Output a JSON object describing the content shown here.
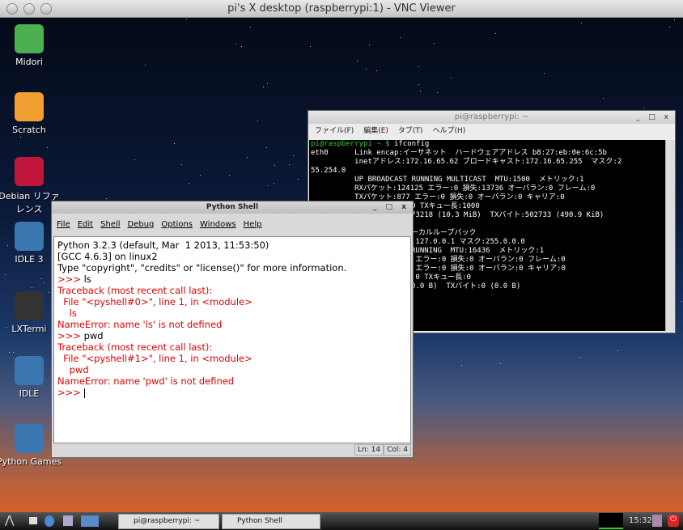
{
  "window": {
    "title": "pi's X desktop (raspberrypi:1) - VNC Viewer"
  },
  "desktop_icons": [
    {
      "label": "Midori",
      "icon": "midori-icon",
      "color": "#4caf50"
    },
    {
      "label": "Scratch",
      "icon": "scratch-icon",
      "color": "#f0a030"
    },
    {
      "label": "Debian リファ\nレンス",
      "icon": "debian-icon",
      "color": "#c0163b"
    },
    {
      "label": "IDLE 3",
      "icon": "python-icon",
      "color": "#3a76b0"
    },
    {
      "label": "LXTermi",
      "icon": "monitor-icon",
      "color": "#333333"
    },
    {
      "label": "IDLE",
      "icon": "python-icon",
      "color": "#3a76b0"
    },
    {
      "label": "Python Games",
      "icon": "python-icon",
      "color": "#3a76b0"
    }
  ],
  "terminal": {
    "title": "pi@raspberrypi: ~",
    "menu": [
      "ファイル(F)",
      "編集(E)",
      "タブ(T)",
      "ヘルプ(H)"
    ],
    "prompt": "pi@raspberrypi ~ $",
    "command": " ifconfig",
    "lines": [
      "eth0      Link encap:イーサネット  ハードウェアアドレス b8:27:eb:0e:6c:5b",
      "          inetアドレス:172.16.65.62 ブロードキャスト:172.16.65.255  マスク:2",
      "55.254.0",
      "          UP BROADCAST RUNNING MULTICAST  MTU:1500  メトリック:1",
      "          RXパケット:124125 エラー:0 損失:13736 オーバラン:0 フレーム:0",
      "          TXパケット:877 エラー:0 損失:0 オーバラン:0 キャリア:0"
    ],
    "fragments": [
      "0 TXキュー長:1000",
      "73218 (10.3 MiB)  TXバイト:502733 (490.9 KiB)",
      "",
      "ーカルループバック",
      " 127.0.0.1 マスク:255.0.0.0",
      "RUNNING  MTU:16436  メトリック:1",
      " エラー:0 損失:0 オーバラン:0 フレーム:0",
      " エラー:0 損失:0 オーバラン:0 キャリア:0",
      " 0 TXキュー長:0",
      "0.0 B)  TXバイト:0 (0.0 B)"
    ]
  },
  "python_shell": {
    "title": "Python Shell",
    "menu": [
      "File",
      "Edit",
      "Shell",
      "Debug",
      "Options",
      "Windows",
      "Help"
    ],
    "lines": [
      {
        "t": "Python 3.2.3 (default, Mar  1 2013, 11:53:50)",
        "c": ""
      },
      {
        "t": "[GCC 4.6.3] on linux2",
        "c": ""
      },
      {
        "t": "Type \"copyright\", \"credits\" or \"license()\" for more information.",
        "c": ""
      },
      {
        "t": ">>> ls",
        "c": "mix"
      },
      {
        "t": "Traceback (most recent call last):",
        "c": "red"
      },
      {
        "t": "  File \"<pyshell#0>\", line 1, in <module>",
        "c": "red"
      },
      {
        "t": "    ls",
        "c": "red"
      },
      {
        "t": "NameError: name 'ls' is not defined",
        "c": "red"
      },
      {
        "t": ">>> pwd",
        "c": "mix"
      },
      {
        "t": "Traceback (most recent call last):",
        "c": "red"
      },
      {
        "t": "  File \"<pyshell#1>\", line 1, in <module>",
        "c": "red"
      },
      {
        "t": "    pwd",
        "c": "red"
      },
      {
        "t": "NameError: name 'pwd' is not defined",
        "c": "red"
      },
      {
        "t": ">>> ",
        "c": "red"
      }
    ],
    "status_line": "Ln: 14",
    "status_col": "Col: 4"
  },
  "taskbar": {
    "tasks": [
      "pi@raspberrypi: ~",
      "Python Shell"
    ],
    "clock": "15:32"
  }
}
